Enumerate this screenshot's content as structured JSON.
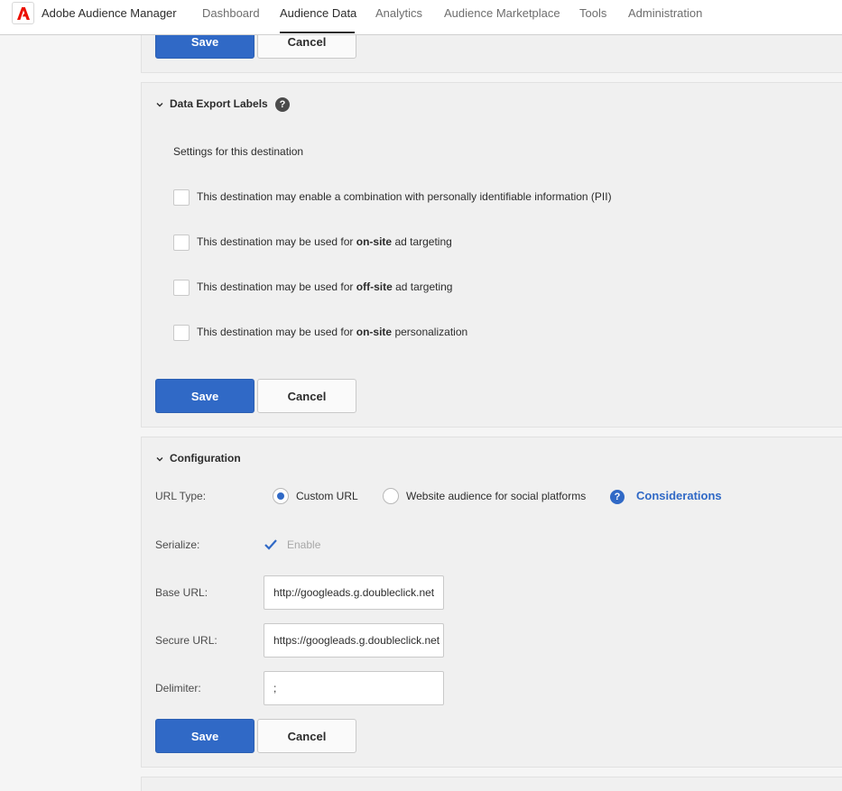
{
  "nav": {
    "app_title": "Adobe Audience Manager",
    "items": [
      {
        "label": "Dashboard"
      },
      {
        "label": "Audience Data"
      },
      {
        "label": "Analytics"
      },
      {
        "label": "Audience Marketplace"
      },
      {
        "label": "Tools"
      },
      {
        "label": "Administration"
      }
    ],
    "active": "Audience Data"
  },
  "top_card": {
    "save_label": "Save",
    "cancel_label": "Cancel"
  },
  "data_export_labels": {
    "title": "Data Export Labels",
    "settings_text": "Settings for this destination",
    "options": [
      {
        "pre": "This destination may enable a combination with personally identifiable information (PII)",
        "bold": "",
        "post": "",
        "checked": false
      },
      {
        "pre": "This destination may be used for ",
        "bold": "on-site",
        "post": " ad targeting",
        "checked": false
      },
      {
        "pre": "This destination may be used for ",
        "bold": "off-site",
        "post": " ad targeting",
        "checked": false
      },
      {
        "pre": "This destination may be used for ",
        "bold": "on-site",
        "post": " personalization",
        "checked": false
      }
    ],
    "save_label": "Save",
    "cancel_label": "Cancel"
  },
  "configuration": {
    "title": "Configuration",
    "url_type": {
      "label": "URL Type:",
      "options": [
        {
          "label": "Custom URL",
          "selected": true
        },
        {
          "label": "Website audience for social platforms",
          "selected": false
        }
      ],
      "considerations_label": "Considerations"
    },
    "serialize": {
      "label": "Serialize:",
      "option_label": "Enable",
      "checked": true,
      "disabled": true
    },
    "base_url": {
      "label": "Base URL:",
      "value": "http://googleads.g.doubleclick.net"
    },
    "secure_url": {
      "label": "Secure URL:",
      "value": "https://googleads.g.doubleclick.net"
    },
    "delimiter": {
      "label": "Delimiter:",
      "value": ";"
    },
    "save_label": "Save",
    "cancel_label": "Cancel"
  },
  "colors": {
    "primary": "#3069c6",
    "nav_active": "#2c2c2c",
    "brand": "#eb1000"
  }
}
